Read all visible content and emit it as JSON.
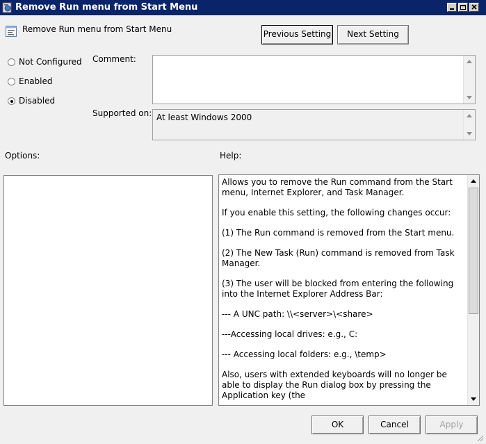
{
  "window": {
    "title": "Remove Run menu from Start Menu",
    "icon": "policy-icon"
  },
  "header": {
    "setting_name": "Remove Run menu from Start Menu",
    "previous_label": "Previous Setting",
    "next_label": "Next Setting"
  },
  "state": {
    "options": [
      {
        "label": "Not Configured",
        "selected": false
      },
      {
        "label": "Enabled",
        "selected": false
      },
      {
        "label": "Disabled",
        "selected": true
      }
    ]
  },
  "comment": {
    "label": "Comment:",
    "value": ""
  },
  "supported": {
    "label": "Supported on:",
    "value": "At least Windows 2000"
  },
  "options_panel": {
    "label": "Options:"
  },
  "help_panel": {
    "label": "Help:",
    "paragraphs": [
      "Allows you to remove the Run command from the Start menu, Internet Explorer, and Task Manager.",
      "If you enable this setting, the following changes occur:",
      "(1) The Run command is removed from the Start menu.",
      "(2) The New Task (Run) command is removed from Task Manager.",
      "(3) The user will be blocked from entering the following into the Internet Explorer Address Bar:",
      "--- A UNC path: \\\\<server>\\<share>",
      "---Accessing local drives:  e.g., C:",
      "--- Accessing local folders: e.g., \\temp>",
      "Also, users with extended keyboards will no longer be able to display the Run dialog box by pressing the Application key (the"
    ]
  },
  "footer": {
    "ok_label": "OK",
    "cancel_label": "Cancel",
    "apply_label": "Apply"
  }
}
